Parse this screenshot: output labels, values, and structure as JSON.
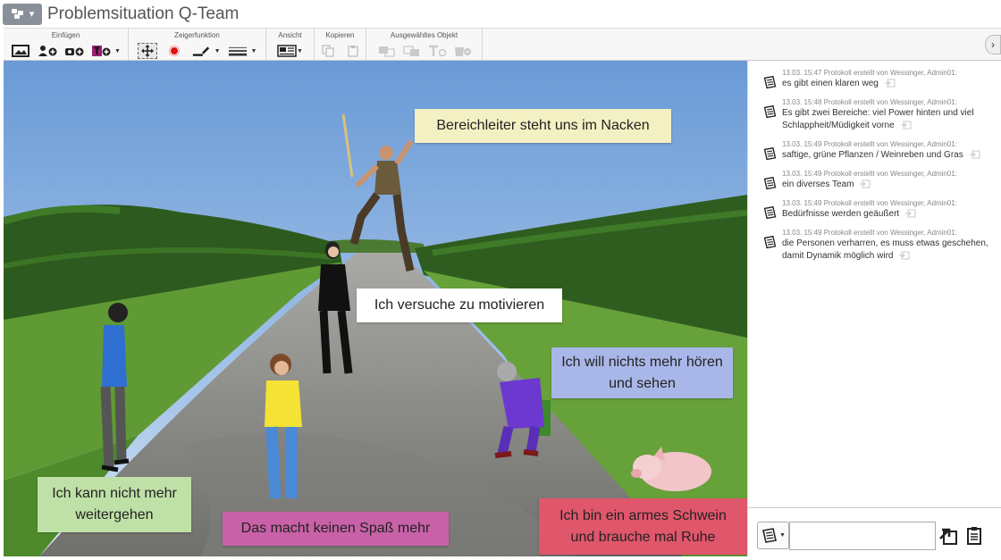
{
  "window": {
    "title": "Problemsituation Q-Team"
  },
  "toolbar": {
    "groups": [
      {
        "label": "Einfügen"
      },
      {
        "label": "Zeigerfunktion"
      },
      {
        "label": "Ansicht"
      },
      {
        "label": "Kopieren"
      },
      {
        "label": "Ausgewähltes Objekt"
      }
    ]
  },
  "notes": [
    {
      "text": "Bereichleiter steht uns im Nacken",
      "color": "#f3f1c4"
    },
    {
      "text": "Ich versuche zu motivieren",
      "color": "#ffffff"
    },
    {
      "text": "Ich will nichts mehr hören und sehen",
      "color": "#a9b7e8"
    },
    {
      "text": "Ich kann nicht mehr weitergehen",
      "color": "#bfe0a6"
    },
    {
      "text": "Das macht keinen Spaß mehr",
      "color": "#c961a8"
    },
    {
      "text": "Ich bin ein armes Schwein und brauche mal Ruhe",
      "color": "#e0566b"
    }
  ],
  "protocol": {
    "entries": [
      {
        "meta": "13.03. 15:47 Protokoll erstellt von Wessinger, Admin01:",
        "text": "es gibt einen klaren weg"
      },
      {
        "meta": "13.03. 15:48 Protokoll erstellt von Wessinger, Admin01:",
        "text": "Es gibt zwei Bereiche: viel Power hinten und viel Schlappheit/Müdigkeit vorne"
      },
      {
        "meta": "13.03. 15:49 Protokoll erstellt von Wessinger, Admin01:",
        "text": "saftige, grüne Pflanzen / Weinreben und Gras"
      },
      {
        "meta": "13.03. 15:49 Protokoll erstellt von Wessinger, Admin01:",
        "text": "ein diverses Team"
      },
      {
        "meta": "13.03. 15:49 Protokoll erstellt von Wessinger, Admin01:",
        "text": "Bedürfnisse werden geäußert"
      },
      {
        "meta": "13.03. 15:49 Protokoll erstellt von Wessinger, Admin01:",
        "text": "die Personen verharren, es muss etwas geschehen, damit Dynamik möglich wird"
      }
    ]
  },
  "input": {
    "value": ""
  },
  "colors": {
    "sky": "#87b3e3",
    "road": "#8b8b8b",
    "grass": "#5f9a35",
    "vines": "#2d5a1e"
  }
}
